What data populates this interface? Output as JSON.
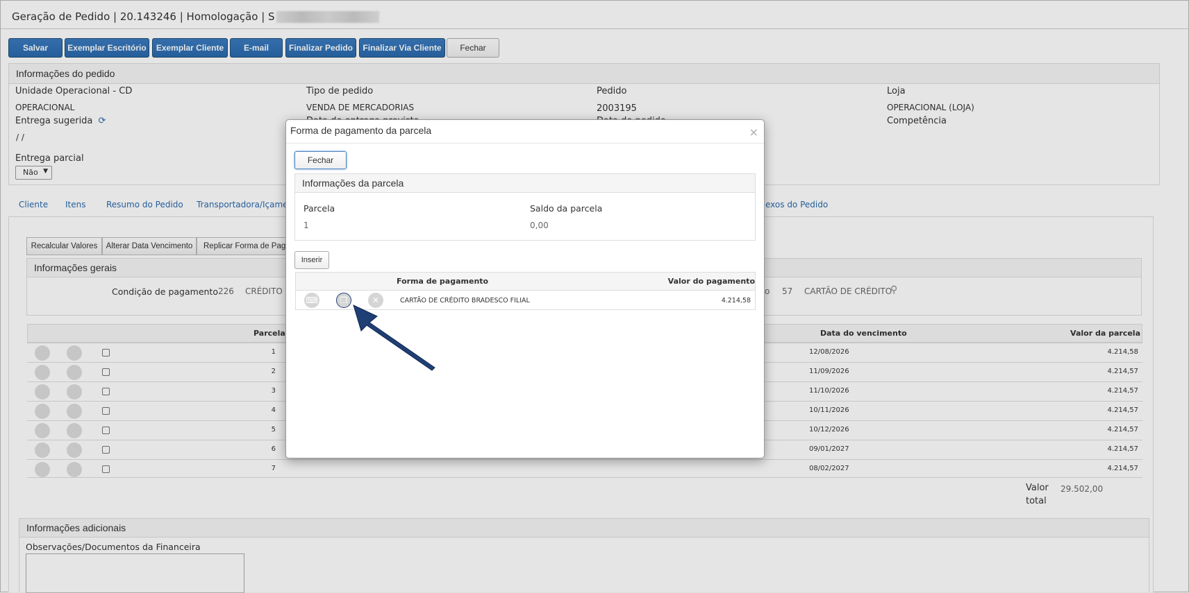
{
  "page": {
    "title": "Geração de Pedido | 20.143246 | Homologação | S"
  },
  "toolbar": {
    "salvar": "Salvar",
    "exemplar_escritorio": "Exemplar Escritório",
    "exemplar_cliente": "Exemplar Cliente",
    "email": "E-mail",
    "finalizar_pedido": "Finalizar Pedido",
    "finalizar_via_cliente": "Finalizar Via Cliente",
    "fechar": "Fechar"
  },
  "order_info": {
    "header": "Informações do pedido",
    "unidade_label": "Unidade Operacional - CD",
    "unidade_value": "OPERACIONAL",
    "tipo_label": "Tipo de pedido",
    "tipo_value": "VENDA DE MERCADORIAS",
    "pedido_label": "Pedido",
    "pedido_value": "2003195",
    "loja_label": "Loja",
    "loja_value": "OPERACIONAL (LOJA)",
    "entrega_sugerida_label": "Entrega sugerida",
    "entrega_sugerida_value": "/ /",
    "data_entrega_label": "Data de entrega prevista",
    "data_pedido_label": "Data do pedido",
    "competencia_label": "Competência",
    "entrega_parcial_label": "Entrega parcial",
    "entrega_parcial_value": "Não"
  },
  "tabs": [
    "Cliente",
    "Itens",
    "Resumo do Pedido",
    "Transportadora/Içament",
    "exos do Pedido"
  ],
  "actions": {
    "recalcular": "Recalcular Valores",
    "alterar_data": "Alterar Data Vencimento",
    "replicar": "Replicar Forma de Pagar"
  },
  "general": {
    "header": "Informações gerais",
    "condicao_label": "Condição de pagamento",
    "condicao_code": "226",
    "condicao_desc": "CRÉDITO 7X",
    "forma_suffix": "o",
    "forma_code": "57",
    "forma_desc": "CARTÃO DE CRÉDITO"
  },
  "installments": {
    "headers": {
      "parcela": "Parcela",
      "vencimento": "Data do vencimento",
      "valor": "Valor da parcela"
    },
    "rows": [
      {
        "parcela": "1",
        "vencimento": "12/08/2026",
        "valor": "4.214,58"
      },
      {
        "parcela": "2",
        "vencimento": "11/09/2026",
        "valor": "4.214,57"
      },
      {
        "parcela": "3",
        "vencimento": "11/10/2026",
        "valor": "4.214,57"
      },
      {
        "parcela": "4",
        "vencimento": "10/11/2026",
        "valor": "4.214,57"
      },
      {
        "parcela": "5",
        "vencimento": "10/12/2026",
        "valor": "4.214,57"
      },
      {
        "parcela": "6",
        "vencimento": "09/01/2027",
        "valor": "4.214,57"
      },
      {
        "parcela": "7",
        "vencimento": "08/02/2027",
        "valor": "4.214,57"
      }
    ],
    "total_label_1": "Valor",
    "total_label_2": "total",
    "total_value": "29.502,00"
  },
  "additional": {
    "header": "Informações adicionais",
    "obs_label": "Observações/Documentos da Financeira"
  },
  "modal": {
    "title": "Forma de pagamento da parcela",
    "close_symbol": "×",
    "fechar": "Fechar",
    "info_header": "Informações da parcela",
    "parcela_label": "Parcela",
    "parcela_value": "1",
    "saldo_label": "Saldo da parcela",
    "saldo_value": "0,00",
    "inserir": "Inserir",
    "col_forma": "Forma de pagamento",
    "col_valor": "Valor do pagamento",
    "row_forma": "CARTÃO DE CRÉDITO BRADESCO FILIAL",
    "row_valor": "4.214,58"
  },
  "colors": {
    "primary": "#2a6aad",
    "link": "#2a6aad",
    "arrow": "#1f3f75"
  }
}
